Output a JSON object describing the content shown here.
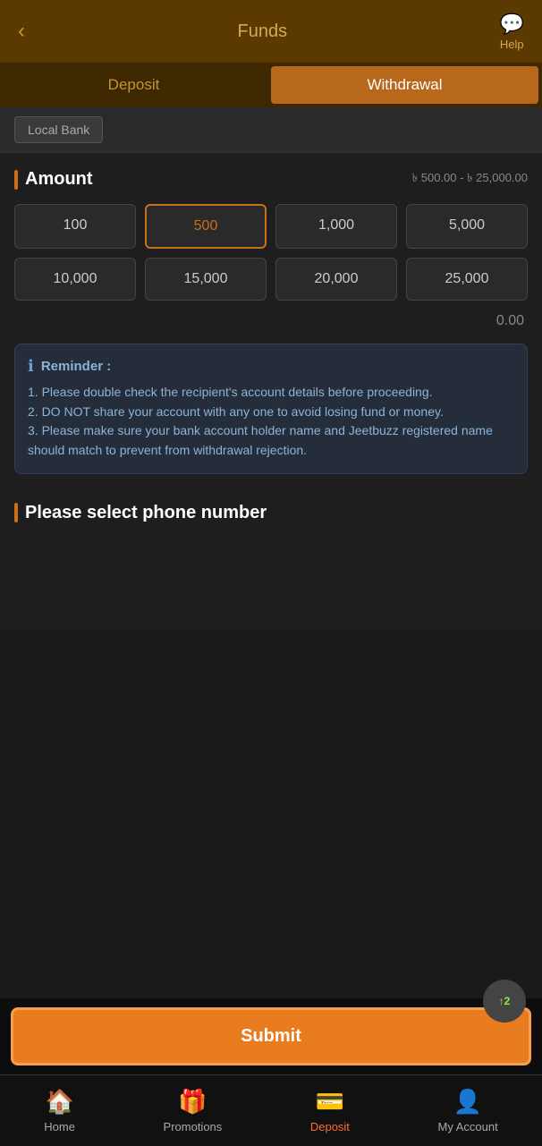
{
  "header": {
    "title": "Funds",
    "back_icon": "‹",
    "help_icon": "💬",
    "help_label": "Help"
  },
  "tabs": [
    {
      "id": "deposit",
      "label": "Deposit",
      "active": false
    },
    {
      "id": "withdrawal",
      "label": "Withdrawal",
      "active": true
    }
  ],
  "bank_row": {
    "label": "Local Bank"
  },
  "amount_section": {
    "title": "Amount",
    "range": "৳ 500.00 - ৳ 25,000.00",
    "amounts": [
      {
        "value": "100",
        "selected": false
      },
      {
        "value": "500",
        "selected": true
      },
      {
        "value": "1,000",
        "selected": false
      },
      {
        "value": "5,000",
        "selected": false
      },
      {
        "value": "10,000",
        "selected": false
      },
      {
        "value": "15,000",
        "selected": false
      },
      {
        "value": "20,000",
        "selected": false
      },
      {
        "value": "25,000",
        "selected": false
      }
    ],
    "balance": "0.00"
  },
  "reminder": {
    "icon": "ℹ",
    "title": "Reminder :",
    "lines": [
      "1. Please double check the recipient's account details before proceeding.",
      "2. DO NOT share your account with any one to avoid losing fund or money.",
      "3. Please make sure your bank account holder name and Jeetbuzz registered name should match to prevent from withdrawal rejection."
    ]
  },
  "phone_section": {
    "title": "Please select phone number"
  },
  "submit_btn": {
    "label": "Submit"
  },
  "float_btn": {
    "label": "↑2"
  },
  "bottom_nav": [
    {
      "id": "home",
      "icon": "🏠",
      "label": "Home",
      "active": false
    },
    {
      "id": "promotions",
      "icon": "🎁",
      "label": "Promotions",
      "active": false
    },
    {
      "id": "deposit",
      "icon": "💳",
      "label": "Deposit",
      "active": false
    },
    {
      "id": "myaccount",
      "icon": "👤",
      "label": "My Account",
      "active": false
    }
  ]
}
